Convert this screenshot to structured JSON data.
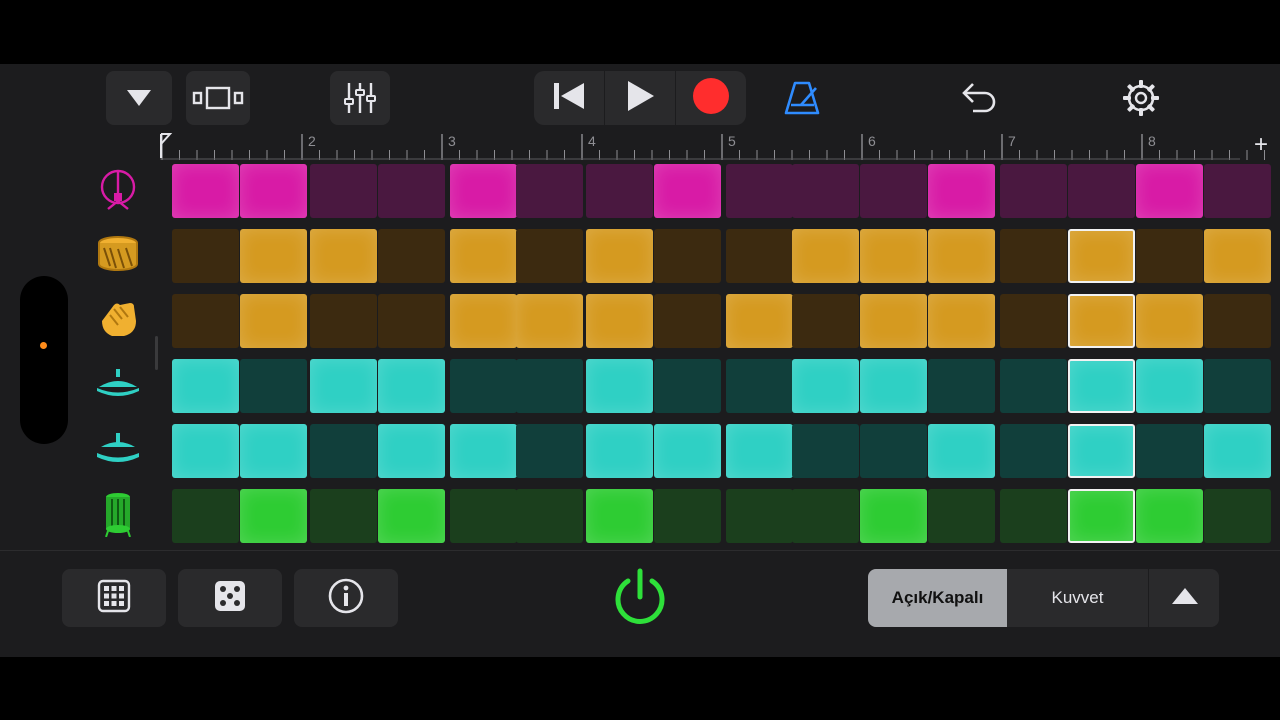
{
  "toolbar": {
    "buttons": [
      {
        "name": "dropdown-button",
        "icon": "triangle-down-icon"
      },
      {
        "name": "view-toggle-button",
        "icon": "tracks-view-icon"
      },
      {
        "name": "mixer-button",
        "icon": "sliders-icon"
      },
      {
        "name": "rewind-button",
        "icon": "rewind-icon"
      },
      {
        "name": "play-button",
        "icon": "play-icon"
      },
      {
        "name": "record-button",
        "icon": "record-icon"
      },
      {
        "name": "metronome-button",
        "icon": "metronome-icon"
      },
      {
        "name": "undo-button",
        "icon": "undo-icon"
      },
      {
        "name": "settings-button",
        "icon": "gear-icon"
      }
    ]
  },
  "ruler": {
    "bars": [
      "2",
      "3",
      "4",
      "5",
      "6",
      "7",
      "8"
    ],
    "add_label": "+"
  },
  "colors": {
    "magenta_on": "#d81ba6",
    "magenta_off": "#4a1840",
    "gold_on": "#d59a20",
    "gold_off": "#3c2a10",
    "cyan_on": "#2fd0c4",
    "cyan_off": "#113f3b",
    "green_on": "#2ecc33",
    "green_off": "#1b3f1d",
    "record": "#ff2d2d",
    "metronome": "#2f8cff",
    "power": "#2ee03a"
  },
  "rows": [
    {
      "instrument": "crash-cymbal-icon",
      "color": "magenta",
      "steps": [
        1,
        1,
        0,
        0,
        1,
        0,
        0,
        1,
        0,
        0,
        0,
        1,
        0,
        0,
        1,
        0
      ]
    },
    {
      "instrument": "snare-drum-icon",
      "color": "gold",
      "steps": [
        0,
        1,
        1,
        0,
        1,
        0,
        1,
        0,
        0,
        1,
        1,
        1,
        0,
        1,
        0,
        1
      ]
    },
    {
      "instrument": "clap-icon",
      "color": "gold",
      "steps": [
        0,
        1,
        0,
        0,
        1,
        1,
        1,
        0,
        1,
        0,
        1,
        1,
        0,
        1,
        1,
        0
      ]
    },
    {
      "instrument": "hihat-closed-icon",
      "color": "cyan",
      "steps": [
        1,
        0,
        1,
        1,
        0,
        0,
        1,
        0,
        0,
        1,
        1,
        0,
        0,
        1,
        1,
        0
      ]
    },
    {
      "instrument": "hihat-open-icon",
      "color": "cyan",
      "steps": [
        1,
        1,
        0,
        1,
        1,
        0,
        1,
        1,
        1,
        0,
        0,
        1,
        0,
        1,
        0,
        1
      ]
    },
    {
      "instrument": "kick-drum-icon",
      "color": "green",
      "steps": [
        0,
        1,
        0,
        1,
        0,
        0,
        1,
        0,
        0,
        0,
        1,
        0,
        0,
        1,
        1,
        0
      ]
    }
  ],
  "playhead_step": 13,
  "bottom": {
    "buttons": [
      {
        "name": "grid-button",
        "icon": "grid-icon"
      },
      {
        "name": "dice-button",
        "icon": "dice-icon"
      },
      {
        "name": "info-button",
        "icon": "info-icon"
      }
    ],
    "power_icon": "power-icon",
    "segment_on_off": "Açık/Kapalı",
    "segment_velocity": "Kuvvet",
    "expand_icon": "triangle-up-icon"
  }
}
